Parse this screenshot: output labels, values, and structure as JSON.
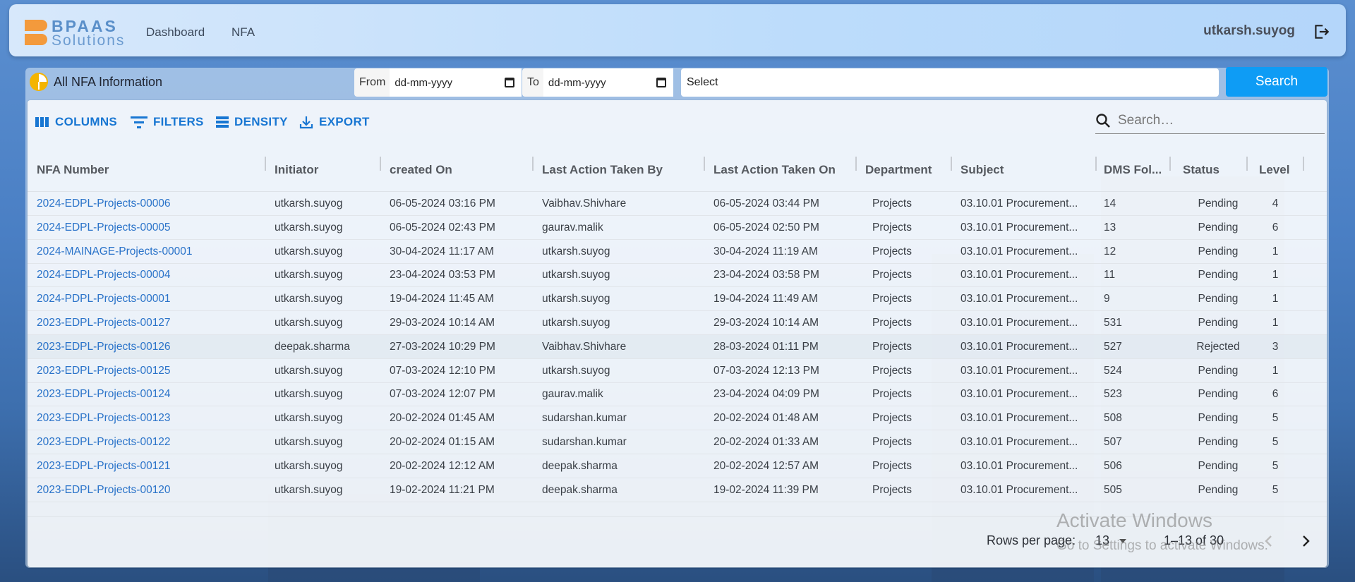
{
  "brand": {
    "line1": "BPAAS",
    "line2": "Solutions",
    "accent": "#f39a3c"
  },
  "nav": {
    "links": [
      "Dashboard",
      "NFA"
    ],
    "user": "utkarsh.suyog"
  },
  "panel": {
    "title": "All NFA Information"
  },
  "filters": {
    "from_label": "From",
    "to_label": "To",
    "from_value": "dd-mm-yyyy",
    "to_value": "dd-mm-yyyy",
    "select_placeholder": "Select",
    "search_button": "Search"
  },
  "toolbar": {
    "columns": "COLUMNS",
    "filters": "FILTERS",
    "density": "DENSITY",
    "export": "EXPORT",
    "search_placeholder": "Search…"
  },
  "table": {
    "headers": [
      "NFA Number",
      "Initiator",
      "created On",
      "Last Action Taken By",
      "Last Action Taken On",
      "Department",
      "Subject",
      "DMS Fol...",
      "Status",
      "Level"
    ],
    "rows": [
      [
        "2024-EDPL-Projects-00006",
        "utkarsh.suyog",
        "06-05-2024 03:16 PM",
        "Vaibhav.Shivhare",
        "06-05-2024 03:44 PM",
        "Projects",
        "03.10.01 Procurement...",
        "14",
        "Pending",
        "4"
      ],
      [
        "2024-EDPL-Projects-00005",
        "utkarsh.suyog",
        "06-05-2024 02:43 PM",
        "gaurav.malik",
        "06-05-2024 02:50 PM",
        "Projects",
        "03.10.01 Procurement...",
        "13",
        "Pending",
        "6"
      ],
      [
        "2024-MAINAGE-Projects-00001",
        "utkarsh.suyog",
        "30-04-2024 11:17 AM",
        "utkarsh.suyog",
        "30-04-2024 11:19 AM",
        "Projects",
        "03.10.01 Procurement...",
        "12",
        "Pending",
        "1"
      ],
      [
        "2024-EDPL-Projects-00004",
        "utkarsh.suyog",
        "23-04-2024 03:53 PM",
        "utkarsh.suyog",
        "23-04-2024 03:58 PM",
        "Projects",
        "03.10.01 Procurement...",
        "11",
        "Pending",
        "1"
      ],
      [
        "2024-PDPL-Projects-00001",
        "utkarsh.suyog",
        "19-04-2024 11:45 AM",
        "utkarsh.suyog",
        "19-04-2024 11:49 AM",
        "Projects",
        "03.10.01 Procurement...",
        "9",
        "Pending",
        "1"
      ],
      [
        "2023-EDPL-Projects-00127",
        "utkarsh.suyog",
        "29-03-2024 10:14 AM",
        "utkarsh.suyog",
        "29-03-2024 10:14 AM",
        "Projects",
        "03.10.01 Procurement...",
        "531",
        "Pending",
        "1"
      ],
      [
        "2023-EDPL-Projects-00126",
        "deepak.sharma",
        "27-03-2024 10:29 PM",
        "Vaibhav.Shivhare",
        "28-03-2024 01:11 PM",
        "Projects",
        "03.10.01 Procurement...",
        "527",
        "Rejected",
        "3"
      ],
      [
        "2023-EDPL-Projects-00125",
        "utkarsh.suyog",
        "07-03-2024 12:10 PM",
        "utkarsh.suyog",
        "07-03-2024 12:13 PM",
        "Projects",
        "03.10.01 Procurement...",
        "524",
        "Pending",
        "1"
      ],
      [
        "2023-EDPL-Projects-00124",
        "utkarsh.suyog",
        "07-03-2024 12:07 PM",
        "gaurav.malik",
        "23-04-2024 04:09 PM",
        "Projects",
        "03.10.01 Procurement...",
        "523",
        "Pending",
        "6"
      ],
      [
        "2023-EDPL-Projects-00123",
        "utkarsh.suyog",
        "20-02-2024 01:45 AM",
        "sudarshan.kumar",
        "20-02-2024 01:48 AM",
        "Projects",
        "03.10.01 Procurement...",
        "508",
        "Pending",
        "5"
      ],
      [
        "2023-EDPL-Projects-00122",
        "utkarsh.suyog",
        "20-02-2024 01:15 AM",
        "sudarshan.kumar",
        "20-02-2024 01:33 AM",
        "Projects",
        "03.10.01 Procurement...",
        "507",
        "Pending",
        "5"
      ],
      [
        "2023-EDPL-Projects-00121",
        "utkarsh.suyog",
        "20-02-2024 12:12 AM",
        "deepak.sharma",
        "20-02-2024 12:57 AM",
        "Projects",
        "03.10.01 Procurement...",
        "506",
        "Pending",
        "5"
      ],
      [
        "2023-EDPL-Projects-00120",
        "utkarsh.suyog",
        "19-02-2024 11:21 PM",
        "deepak.sharma",
        "19-02-2024 11:39 PM",
        "Projects",
        "03.10.01 Procurement...",
        "505",
        "Pending",
        "5"
      ]
    ],
    "selected_row": 6
  },
  "pagination": {
    "rows_per_page_label": "Rows per page:",
    "rows_per_page_value": "13",
    "range": "1–13 of 30"
  },
  "watermark": {
    "line1": "Activate Windows",
    "line2": "Go to Settings to activate Windows."
  },
  "colors": {
    "link": "#2a73c9",
    "primary": "#1876d2",
    "search_button": "#0e9cf5"
  }
}
